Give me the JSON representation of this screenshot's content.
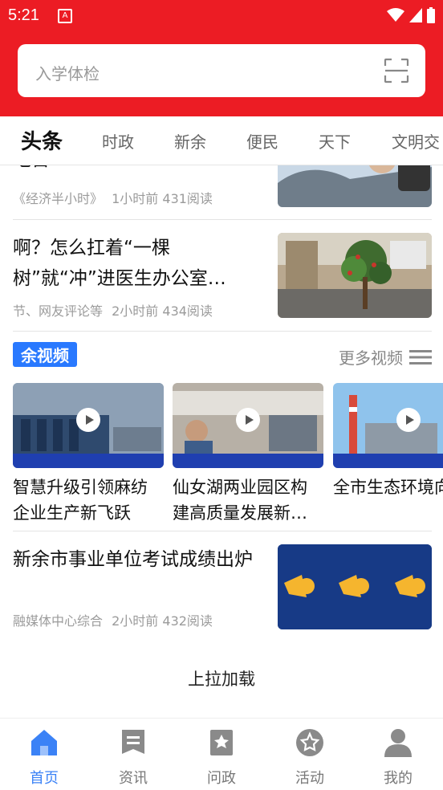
{
  "status": {
    "time": "5:21"
  },
  "search": {
    "placeholder": "入学体检"
  },
  "tabs": [
    "头条",
    "时政",
    "新余",
    "便民",
    "天下",
    "文明交"
  ],
  "news": [
    {
      "title": "吃苦",
      "source": "《经济半小时》",
      "time": "1小时前",
      "reads": "431阅读"
    },
    {
      "title": "啊？怎么扛着“一棵树”就“冲”进医生办公室…",
      "source": "节、网友评论等",
      "time": "2小时前",
      "reads": "434阅读"
    },
    {
      "title": "新余市事业单位考试成绩出炉",
      "source": "融媒体中心综合",
      "time": "2小时前",
      "reads": "432阅读"
    }
  ],
  "videos": {
    "badge": "余视频",
    "more": "更多视频",
    "items": [
      {
        "title": "智慧升级引领麻纺企业生产新飞跃"
      },
      {
        "title": "仙女湖两业园区构建高质量发展新…"
      },
      {
        "title": "全市生态环境向好"
      }
    ]
  },
  "load_more": "上拉加载",
  "bottom_nav": [
    "首页",
    "资讯",
    "问政",
    "活动",
    "我的"
  ],
  "colors": {
    "brand_red": "#ec1c24",
    "active_blue": "#3b82f6",
    "video_badge": "#2979ff"
  }
}
